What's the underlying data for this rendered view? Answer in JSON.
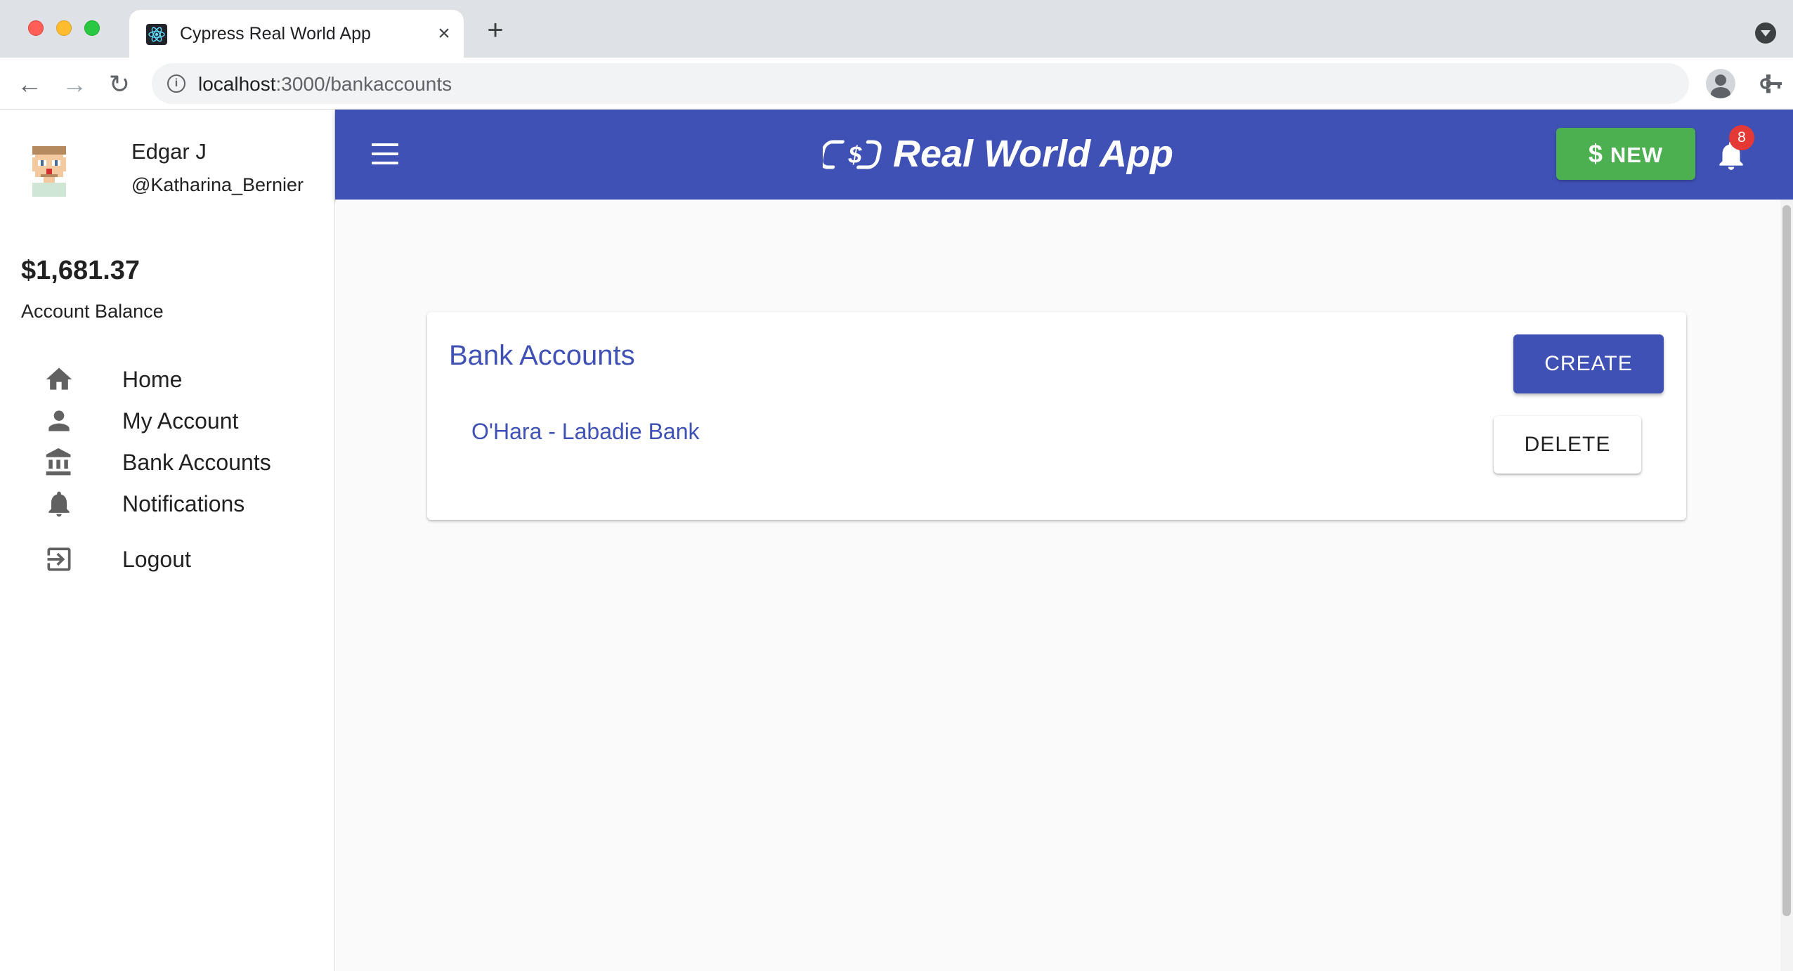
{
  "browser": {
    "tab_title": "Cypress Real World App",
    "url_host": "localhost",
    "url_path": ":3000/bankaccounts"
  },
  "user": {
    "name": "Edgar J",
    "handle": "@Katharina_Bernier"
  },
  "balance": {
    "amount": "$1,681.37",
    "label": "Account Balance"
  },
  "sidebar": {
    "items": [
      {
        "label": "Home",
        "icon": "home-icon"
      },
      {
        "label": "My Account",
        "icon": "person-icon"
      },
      {
        "label": "Bank Accounts",
        "icon": "bank-icon"
      },
      {
        "label": "Notifications",
        "icon": "bell-icon"
      },
      {
        "label": "Logout",
        "icon": "logout-icon"
      }
    ]
  },
  "header": {
    "title": "Real World App",
    "new_label": "NEW",
    "new_symbol": "$",
    "notification_count": "8"
  },
  "bank_accounts": {
    "title": "Bank Accounts",
    "create_label": "CREATE",
    "accounts": [
      {
        "name": "O'Hara - Labadie Bank",
        "delete_label": "DELETE"
      }
    ]
  },
  "colors": {
    "primary": "#3f51b5",
    "new_button": "#4caf50",
    "badge": "#e53935"
  }
}
